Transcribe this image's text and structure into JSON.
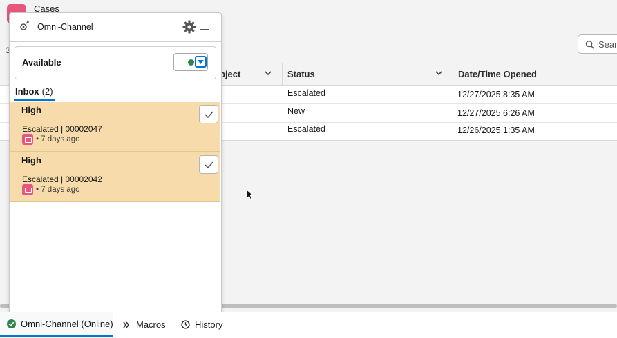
{
  "page": {
    "title": "Cases",
    "stray_text": "3"
  },
  "search": {
    "label": "Search"
  },
  "table": {
    "columns": [
      {
        "label": "bject"
      },
      {
        "label": "Status"
      },
      {
        "label": "Date/Time Opened"
      }
    ],
    "rows": [
      {
        "status": "Escalated",
        "opened": "12/27/2025 8:35 AM"
      },
      {
        "status": "New",
        "opened": "12/27/2025 6:26 AM"
      },
      {
        "status": "Escalated",
        "opened": "12/26/2025 1:35 AM"
      }
    ]
  },
  "omni": {
    "title": "Omni-Channel",
    "status": "Available",
    "status_color": "#2e844a",
    "inbox_label": "Inbox",
    "inbox_count": "(2)",
    "work_items": [
      {
        "priority": "High",
        "line": "Escalated | 00002047",
        "age": "• 7 days ago"
      },
      {
        "priority": "High",
        "line": "Escalated | 00002042",
        "age": "• 7 days ago"
      }
    ]
  },
  "utility_bar": {
    "omni_label": "Omni-Channel (Online)",
    "macros_label": "Macros",
    "history_label": "History"
  },
  "colors": {
    "accent": "#0176d3",
    "card_bg": "#f7dbaa",
    "case_icon": "#e8557f"
  }
}
